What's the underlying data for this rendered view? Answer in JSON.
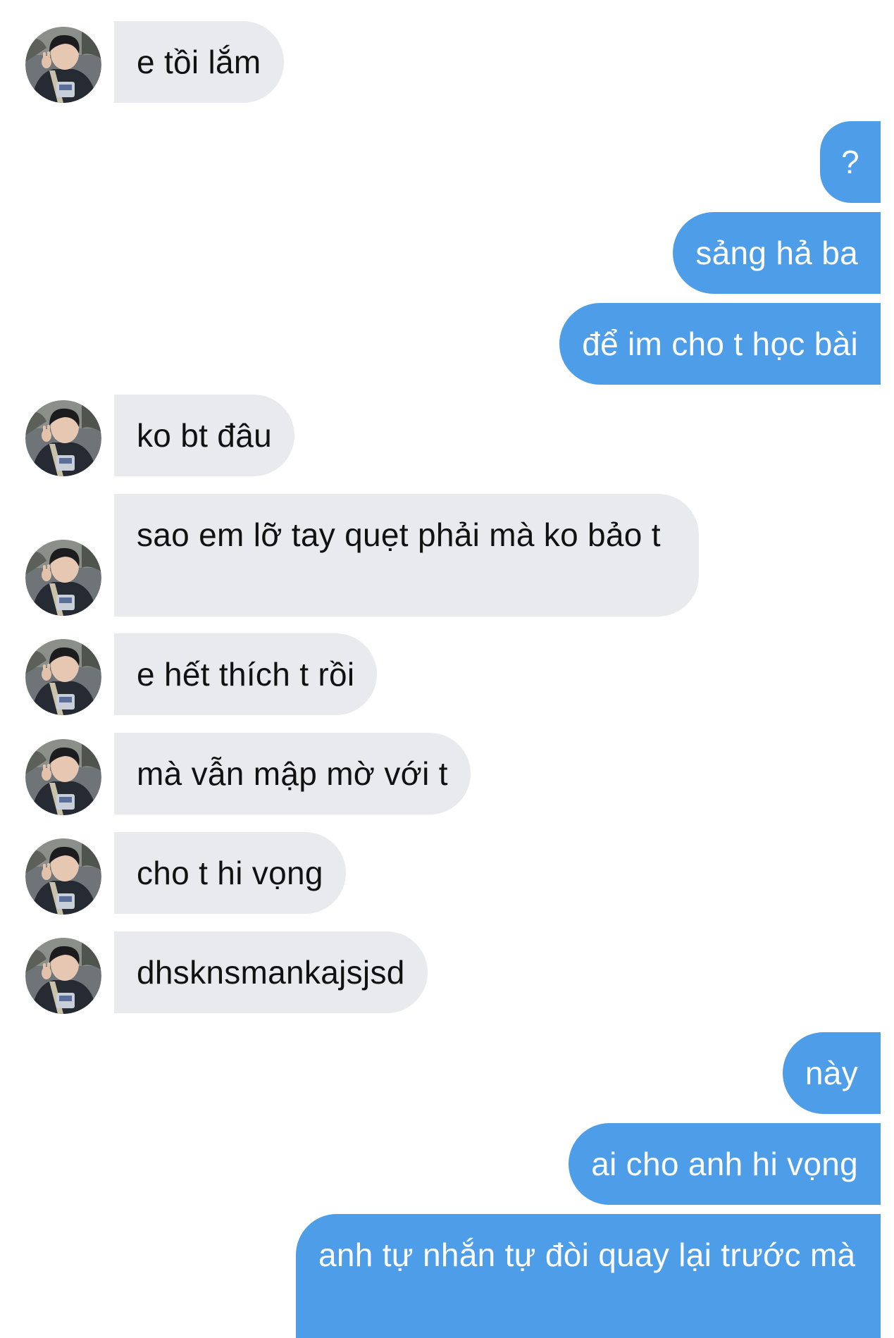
{
  "conversation": {
    "messages": [
      {
        "id": "m1",
        "direction": "incoming",
        "text": "e tồi lắm",
        "avatar": "contact-avatar-photo"
      },
      {
        "id": "m2",
        "direction": "outgoing",
        "text": "?"
      },
      {
        "id": "m3",
        "direction": "outgoing",
        "text": "sảng hả ba"
      },
      {
        "id": "m4",
        "direction": "outgoing",
        "text": "để im cho t học bài"
      },
      {
        "id": "m5",
        "direction": "incoming",
        "text": "ko bt đâu",
        "avatar": "contact-avatar-photo"
      },
      {
        "id": "m6",
        "direction": "incoming",
        "text": "sao em lỡ tay quẹt phải mà ko bảo t",
        "avatar": "contact-avatar-photo"
      },
      {
        "id": "m7",
        "direction": "incoming",
        "text": "e hết thích t rồi",
        "avatar": "contact-avatar-photo"
      },
      {
        "id": "m8",
        "direction": "incoming",
        "text": "mà vẫn mập mờ với t",
        "avatar": "contact-avatar-photo"
      },
      {
        "id": "m9",
        "direction": "incoming",
        "text": "cho t hi vọng",
        "avatar": "contact-avatar-photo"
      },
      {
        "id": "m10",
        "direction": "incoming",
        "text": "dhsknsmankajsjsd",
        "avatar": "contact-avatar-photo"
      },
      {
        "id": "m11",
        "direction": "outgoing",
        "text": "này"
      },
      {
        "id": "m12",
        "direction": "outgoing",
        "text": "ai cho anh hi vọng"
      },
      {
        "id": "m13",
        "direction": "outgoing",
        "text": "anh tự nhắn tự đòi quay lại trước mà"
      }
    ]
  },
  "colors": {
    "background": "#ffffff",
    "incoming_bubble": "#e9eaed",
    "incoming_text": "#111111",
    "outgoing_bubble": "#4d9de8",
    "outgoing_text": "#ffffff"
  }
}
